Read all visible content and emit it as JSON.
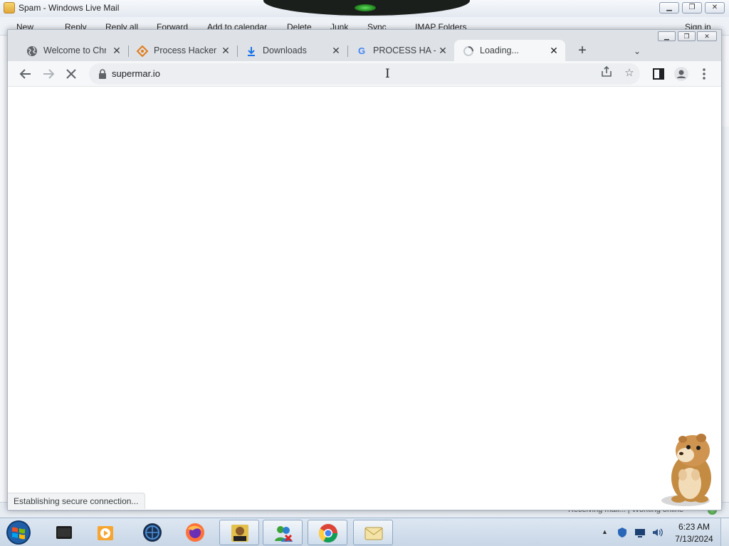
{
  "background_window": {
    "title": "Spam - Windows Live Mail",
    "toolbar": [
      "New",
      "Reply",
      "Reply all",
      "Forward",
      "Add to calendar",
      "Delete",
      "Junk",
      "Sync",
      "IMAP Folders",
      "Sign in"
    ],
    "status_right": "Receiving mail... | Working online"
  },
  "browser": {
    "tabs": [
      {
        "title": "Welcome to Chrome",
        "icon": "globe-icon"
      },
      {
        "title": "Process Hacker - Overview",
        "icon": "process-hacker-icon"
      },
      {
        "title": "Downloads",
        "icon": "download-icon"
      },
      {
        "title": "PROCESS HA - Google Search",
        "icon": "google-icon"
      },
      {
        "title": "Loading...",
        "icon": "spinner-icon",
        "active": true
      }
    ],
    "address": "supermar.io",
    "status_bubble": "Establishing secure connection..."
  },
  "taskbar": {
    "apps": [
      "Windows Explorer",
      "Media Player",
      "Network",
      "Firefox",
      "Sandboxie",
      "Windows Live Messenger",
      "Google Chrome",
      "Windows Live Mail"
    ],
    "clock": {
      "time": "6:23 AM",
      "date": "7/13/2024"
    }
  }
}
